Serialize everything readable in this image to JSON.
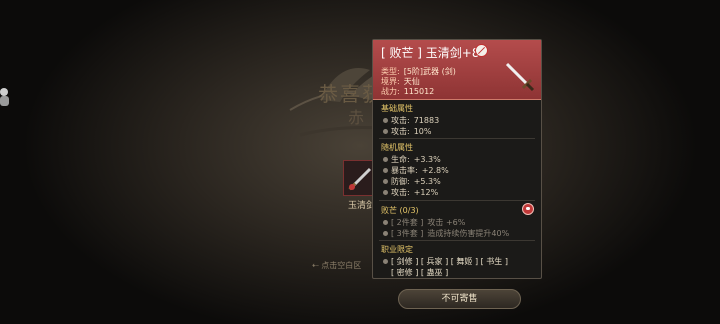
{
  "background": {
    "banner_title": "恭喜获",
    "banner_sub": "赤",
    "item_slot_label": "玉清剑",
    "hint": "点击空白区"
  },
  "tooltip": {
    "item_name": "[ 败芒 ] 玉清剑+8",
    "meta": [
      {
        "key": "类型:",
        "value": "[5阶]武器 (剑)"
      },
      {
        "key": "境界:",
        "value": "天仙"
      },
      {
        "key": "战力:",
        "value": "115012"
      }
    ],
    "base_title": "基础属性",
    "base_stats": [
      {
        "key": "攻击:",
        "value": "71883"
      },
      {
        "key": "攻击:",
        "value": "10%"
      }
    ],
    "random_title": "随机属性",
    "random_stats": [
      {
        "key": "生命:",
        "value": "+3.3%"
      },
      {
        "key": "暴击率:",
        "value": "+2.8%"
      },
      {
        "key": "防御:",
        "value": "+5.3%"
      },
      {
        "key": "攻击:",
        "value": "+12%"
      }
    ],
    "set_title": "败芒 (0/3)",
    "set_bonuses": [
      {
        "key": "[ 2件套 ]",
        "value": "攻击 +6%"
      },
      {
        "key": "[ 3件套 ]",
        "value": "造成持续伤害提升40%"
      }
    ],
    "class_title": "职业限定",
    "classes_line1": "[ 剑修 ] [ 兵家 ] [ 舞姬 ] [ 书生 ]",
    "classes_line2": "[ 密修 ] [ 蛊巫 ]"
  },
  "sell_button": "不可寄售",
  "colors": {
    "header": "#a54040",
    "section_title": "#e6c76a",
    "panel": "#1b1a18"
  }
}
